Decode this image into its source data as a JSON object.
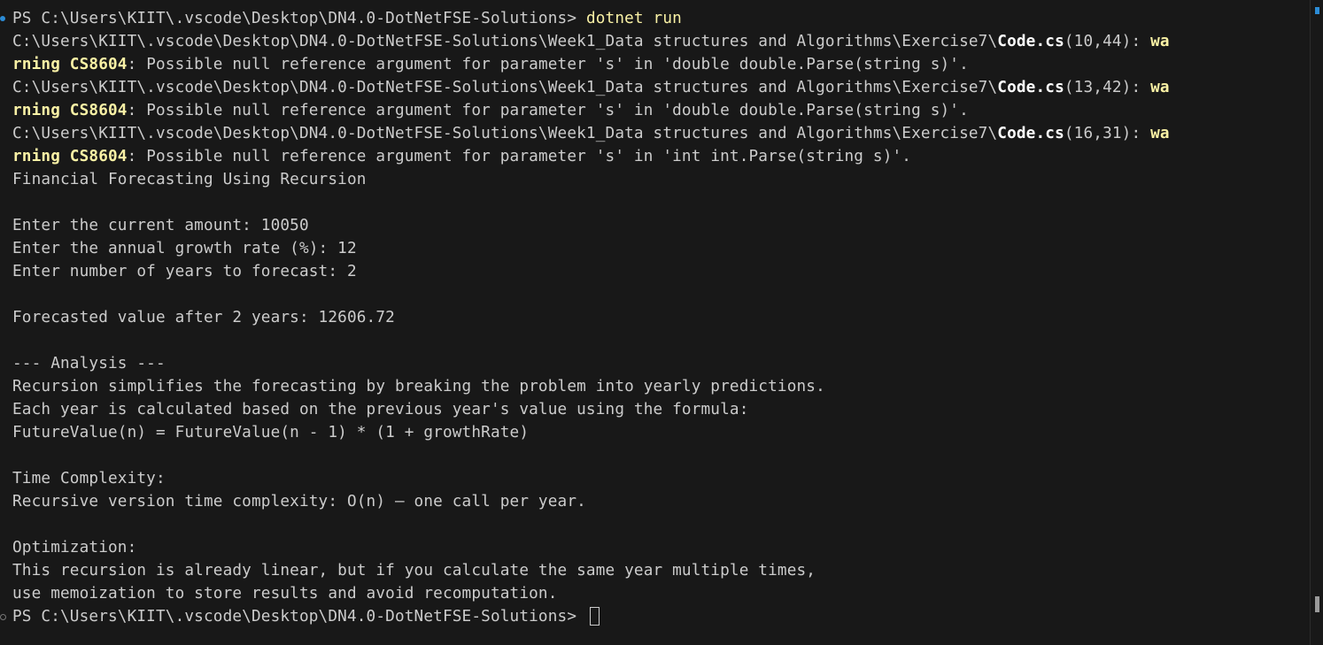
{
  "terminal": {
    "prompt_1": "PS C:\\Users\\KIIT\\.vscode\\Desktop\\DN4.0-DotNetFSE-Solutions> ",
    "command_1": "dotnet run",
    "warning_path_prefix": "C:\\Users\\KIIT\\.vscode\\Desktop\\DN4.0-DotNetFSE-Solutions\\Week1_Data structures and Algorithms\\Exercise7\\",
    "warning_file": "Code.cs",
    "warnings": [
      {
        "location": "(10,44): ",
        "wa": "wa",
        "rning": "rning",
        "code": " CS8604",
        "message": ": Possible null reference argument for parameter 's' in 'double double.Parse(string s)'."
      },
      {
        "location": "(13,42): ",
        "wa": "wa",
        "rning": "rning",
        "code": " CS8604",
        "message": ": Possible null reference argument for parameter 's' in 'double double.Parse(string s)'."
      },
      {
        "location": "(16,31): ",
        "wa": "wa",
        "rning": "rning",
        "code": " CS8604",
        "message": ": Possible null reference argument for parameter 's' in 'int int.Parse(string s)'."
      }
    ],
    "output_lines": [
      "Financial Forecasting Using Recursion",
      "",
      "Enter the current amount: 10050",
      "Enter the annual growth rate (%): 12",
      "Enter number of years to forecast: 2",
      "",
      "Forecasted value after 2 years: 12606.72",
      "",
      "--- Analysis ---",
      "Recursion simplifies the forecasting by breaking the problem into yearly predictions.",
      "Each year is calculated based on the previous year's value using the formula:",
      "FutureValue(n) = FutureValue(n - 1) * (1 + growthRate)",
      "",
      "Time Complexity:",
      "Recursive version time complexity: O(n) — one call per year.",
      "",
      "Optimization:",
      "This recursion is already linear, but if you calculate the same year multiple times,",
      "use memoization to store results and avoid recomputation."
    ],
    "prompt_2": "PS C:\\Users\\KIIT\\.vscode\\Desktop\\DN4.0-DotNetFSE-Solutions> ",
    "colors": {
      "background": "#181818",
      "text": "#cccccc",
      "command": "#f9f1a5",
      "warning": "#f9f1a5",
      "decoration_success": "#2c8cd6"
    }
  }
}
